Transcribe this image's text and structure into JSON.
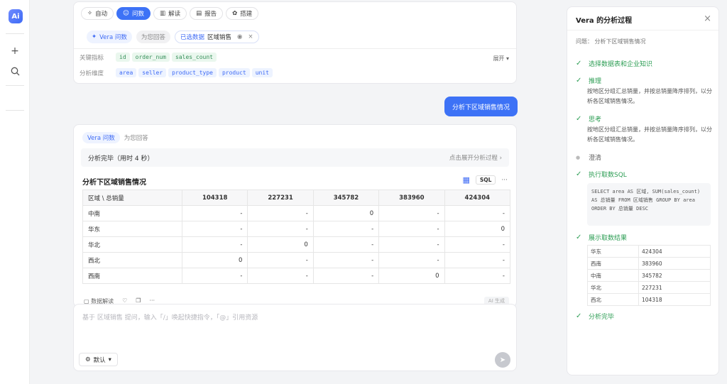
{
  "toolbar": {
    "tabs": [
      {
        "label": "自动",
        "icon": "sparkle-icon"
      },
      {
        "label": "问数",
        "icon": "chat-icon",
        "active": true
      },
      {
        "label": "解读",
        "icon": "book-icon"
      },
      {
        "label": "报告",
        "icon": "report-icon"
      },
      {
        "label": "搭建",
        "icon": "build-icon"
      }
    ]
  },
  "context": {
    "vera_label": "Vera 问数",
    "answer_for": "为您回答",
    "selected_prefix": "已选数据",
    "selected_table": "区域销售",
    "metrics_label": "关键指标",
    "metrics": [
      "id",
      "order_num",
      "sales_count"
    ],
    "dims_label": "分析维度",
    "dims": [
      "area",
      "seller",
      "product_type",
      "product",
      "unit"
    ],
    "expand": "展开"
  },
  "user_message": "分析下区域销售情况",
  "answer": {
    "vera_label": "Vera 问数",
    "answer_for": "为您回答",
    "status": "分析完毕（用时 4 秒）",
    "expand_process": "点击展开分析过程",
    "title": "分析下区域销售情况",
    "sql_btn": "SQL",
    "more": "···",
    "table": {
      "corner": "区域 \\ 总销量",
      "columns": [
        "104318",
        "227231",
        "345782",
        "383960",
        "424304"
      ],
      "rows": [
        {
          "name": "中南",
          "cells": [
            "-",
            "-",
            "0",
            "-",
            "-"
          ]
        },
        {
          "name": "华东",
          "cells": [
            "-",
            "-",
            "-",
            "-",
            "0"
          ]
        },
        {
          "name": "华北",
          "cells": [
            "-",
            "0",
            "-",
            "-",
            "-"
          ]
        },
        {
          "name": "西北",
          "cells": [
            "0",
            "-",
            "-",
            "-",
            "-"
          ]
        },
        {
          "name": "西南",
          "cells": [
            "-",
            "-",
            "-",
            "0",
            "-"
          ]
        }
      ]
    },
    "footer_label": "数据解读",
    "footer_right": "AI 生成"
  },
  "composer": {
    "placeholder": "基于 区域销售 提问，输入「/」唤起快捷指令，「@」引用资源",
    "model": "默认"
  },
  "panel": {
    "title": "Vera 的分析过程",
    "question_label": "问题：",
    "question": "分析下区域销售情况",
    "steps": [
      {
        "title": "选择数据表和企业知识",
        "status": "done"
      },
      {
        "title": "推理",
        "status": "done",
        "desc": "按地区分组汇总销量，并按总销量降序排列，以分析各区域销售情况。"
      },
      {
        "title": "思考",
        "status": "done",
        "desc": "按地区分组汇总销量，并按总销量降序排列，以分析各区域销售情况。"
      },
      {
        "title": "澄清",
        "status": "pending"
      },
      {
        "title": "执行取数SQL",
        "status": "done"
      },
      {
        "title": "展示取数结果",
        "status": "done"
      },
      {
        "title": "分析完毕",
        "status": "done"
      }
    ],
    "sql": "SELECT area AS 区域, SUM(sales_count) AS 总销量 FROM 区域销售 GROUP BY area ORDER BY 总销量 DESC",
    "result": [
      [
        "华东",
        "424304"
      ],
      [
        "西南",
        "383960"
      ],
      [
        "中南",
        "345782"
      ],
      [
        "华北",
        "227231"
      ],
      [
        "西北",
        "104318"
      ]
    ]
  }
}
